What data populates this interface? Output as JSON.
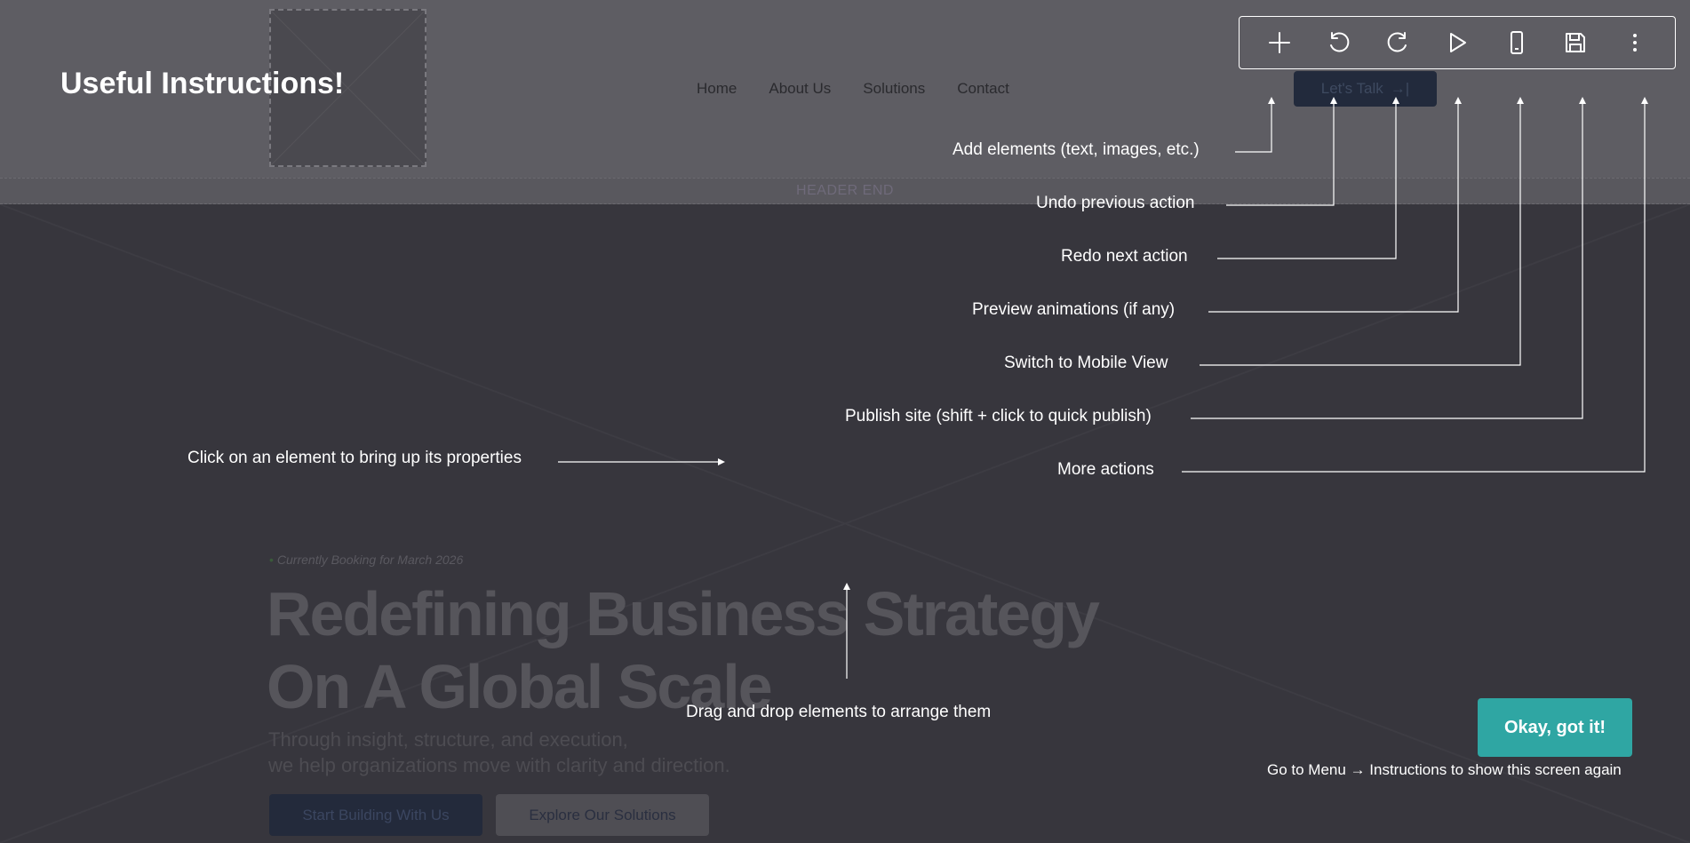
{
  "overlay": {
    "title": "Useful Instructions!",
    "toolbar": {
      "tools": [
        {
          "icon": "plus-icon",
          "label": "Add elements (text, images, etc.)"
        },
        {
          "icon": "undo-icon",
          "label": "Undo previous action"
        },
        {
          "icon": "redo-icon",
          "label": "Redo next action"
        },
        {
          "icon": "play-icon",
          "label": "Preview animations (if any)"
        },
        {
          "icon": "mobile-icon",
          "label": "Switch to Mobile View"
        },
        {
          "icon": "save-icon",
          "label": "Publish site (shift + click to quick publish)"
        },
        {
          "icon": "more-vertical-icon",
          "label": "More actions"
        }
      ]
    },
    "click_hint": "Click on an element to bring up its properties",
    "drag_hint": "Drag and drop elements to arrange them",
    "okay_label": "Okay, got it!",
    "reopen_hint": "Go to Menu → Instructions to show this screen again",
    "text_color": "#ffffff",
    "okay_color": "#2fa6a3"
  },
  "site": {
    "nav": [
      "Home",
      "About Us",
      "Solutions",
      "Contact"
    ],
    "cta": "Let's Talk",
    "header_end_label": "HEADER END",
    "tagline": "Currently Booking for March 2026",
    "headline_line1": "Redefining Business Strategy",
    "headline_line2": "On A Global Scale",
    "sub_line1": "Through insight, structure, and execution,",
    "sub_line2": "we help organizations move with clarity and direction.",
    "primary_button": "Start Building With Us",
    "secondary_button": "Explore Our Solutions"
  }
}
